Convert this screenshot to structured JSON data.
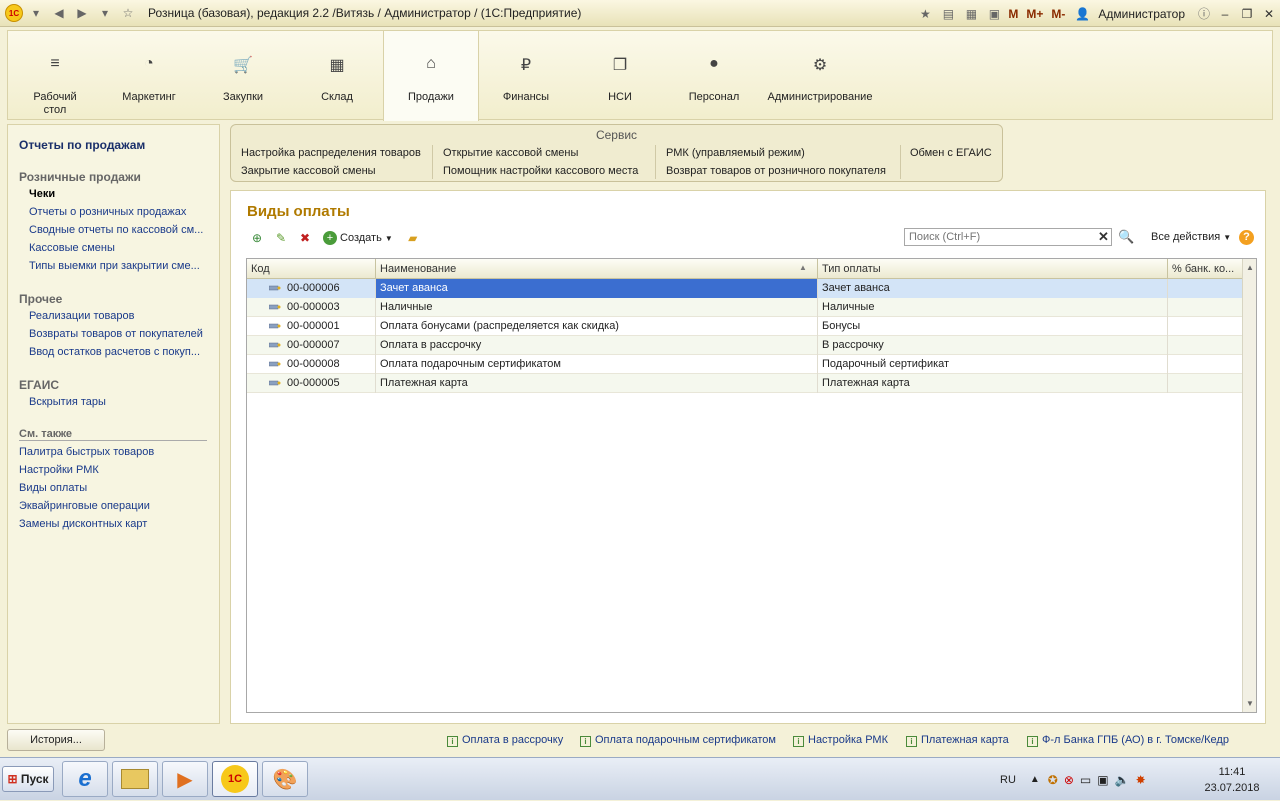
{
  "window": {
    "title": "Розница (базовая), редакция 2.2 /Витязь / Администратор /  (1С:Предприятие)",
    "logo": "1С",
    "quick_m": "M",
    "quick_mplus": "M+",
    "quick_mminus": "M-",
    "user": "Администратор"
  },
  "sections": [
    {
      "label": "Рабочий стол",
      "icon": "menu-icon",
      "glyph": "≡"
    },
    {
      "label": "Маркетинг",
      "icon": "pie-chart-icon",
      "glyph": "◔"
    },
    {
      "label": "Закупки",
      "icon": "cart-icon",
      "glyph": "🛒"
    },
    {
      "label": "Склад",
      "icon": "warehouse-grid-icon",
      "glyph": "▦"
    },
    {
      "label": "Продажи",
      "icon": "basket-icon",
      "glyph": "⌂"
    },
    {
      "label": "Финансы",
      "icon": "ruble-icon",
      "glyph": "₽"
    },
    {
      "label": "НСИ",
      "icon": "documents-icon",
      "glyph": "❐"
    },
    {
      "label": "Персонал",
      "icon": "person-icon",
      "glyph": "●"
    },
    {
      "label": "Администрирование",
      "icon": "gear-icon",
      "glyph": "⚙"
    }
  ],
  "left_panel": {
    "header": "Отчеты по продажам",
    "groups": [
      {
        "title": "Розничные продажи",
        "items": [
          "Чеки",
          "Отчеты о розничных продажах",
          "Сводные отчеты по кассовой см...",
          "Кассовые смены",
          "Типы выемки при закрытии сме..."
        ]
      },
      {
        "title": "Прочее",
        "items": [
          "Реализации товаров",
          "Возвраты товаров от покупателей",
          "Ввод остатков расчетов с покуп..."
        ]
      },
      {
        "title": "ЕГАИС",
        "items": [
          "Вскрытия тары"
        ]
      }
    ],
    "see_also_title": "См. также",
    "see_also": [
      "Палитра быстрых товаров",
      "Настройки РМК",
      "Виды оплаты",
      "Эквайринговые операции",
      "Замены дисконтных карт"
    ]
  },
  "service": {
    "title": "Сервис",
    "links": [
      [
        "Настройка распределения товаров",
        "Закрытие кассовой смены"
      ],
      [
        "Открытие кассовой смены",
        "Помощник настройки кассового места"
      ],
      [
        "РМК (управляемый режим)",
        "Возврат товаров от розничного покупателя"
      ],
      [
        "Обмен с ЕГАИС"
      ]
    ]
  },
  "main": {
    "title": "Виды оплаты",
    "create_label": "Создать",
    "search_placeholder": "Поиск (Ctrl+F)",
    "all_actions": "Все действия",
    "columns": [
      "Код",
      "Наименование",
      "Тип оплаты",
      "% банк. ко..."
    ],
    "rows": [
      {
        "code": "00-000006",
        "name": "Зачет аванса",
        "type": "Зачет аванса",
        "pct": ""
      },
      {
        "code": "00-000003",
        "name": "Наличные",
        "type": "Наличные",
        "pct": ""
      },
      {
        "code": "00-000001",
        "name": "Оплата бонусами (распределяется как скидка)",
        "type": "Бонусы",
        "pct": ""
      },
      {
        "code": "00-000007",
        "name": "Оплата в рассрочку",
        "type": "В рассрочку",
        "pct": ""
      },
      {
        "code": "00-000008",
        "name": "Оплата подарочным сертификатом",
        "type": "Подарочный сертификат",
        "pct": ""
      },
      {
        "code": "00-000005",
        "name": "Платежная карта",
        "type": "Платежная карта",
        "pct": ""
      }
    ],
    "selected_row": 0
  },
  "history": {
    "button": "История...",
    "items": [
      "Оплата в рассрочку",
      "Оплата подарочным сертификатом",
      "Настройка РМК",
      "Платежная карта",
      "Ф-л Банка ГПБ (АО) в г. Томске/Кедр"
    ]
  },
  "taskbar": {
    "start": "Пуск",
    "lang": "RU",
    "time": "11:41",
    "date": "23.07.2018"
  }
}
